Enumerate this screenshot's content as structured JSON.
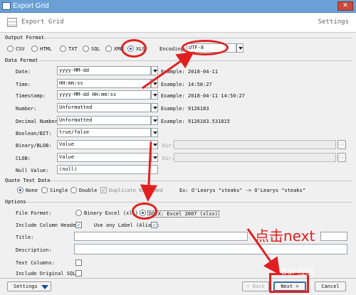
{
  "window": {
    "title": "Export Grid",
    "close_glyph": "✕"
  },
  "header": {
    "title": "Export Grid",
    "settings_label": "Settings"
  },
  "output_format": {
    "section_label": "Output Format",
    "options": [
      "CSV",
      "HTML",
      "TXT",
      "SQL",
      "XML",
      "XLS"
    ],
    "selected": "XLS",
    "encoding_label": "Encoding:",
    "encoding_value": "UTF-8"
  },
  "data_format": {
    "section_label": "Data Format",
    "rows": [
      {
        "label": "Date:",
        "value": "yyyy-MM-dd",
        "example": "Example: 2018-04-11"
      },
      {
        "label": "Time:",
        "value": "HH:mm:ss",
        "example": "Example: 14:50:27"
      },
      {
        "label": "Timestamp:",
        "value": "yyyy-MM-dd HH:mm:ss",
        "example": "Example: 2018-04-11 14:50:27"
      },
      {
        "label": "Number:",
        "value": "Unformatted",
        "example": "Example: 9126183"
      },
      {
        "label": "Decimal Number:",
        "value": "Unformatted",
        "example": "Example: 9126183.531815"
      },
      {
        "label": "Boolean/BIT:",
        "value": "true/false",
        "example": ""
      },
      {
        "label": "Binary/BLOB:",
        "value": "Value",
        "example": ""
      },
      {
        "label": "CLOB:",
        "value": "Value",
        "example": ""
      },
      {
        "label": "Null Value:",
        "value": "(null)",
        "example": ""
      }
    ],
    "dir_label": "Dir:",
    "browse_label": "..."
  },
  "quote_text": {
    "section_label": "Quote Text Data",
    "options": [
      "None",
      "Single",
      "Double"
    ],
    "selected": "None",
    "dup_embedded_label": "Duplicate Embedded",
    "example": "Ex: O'Learys \"steaks\" -> O'Learys \"steaks\""
  },
  "options": {
    "section_label": "Options",
    "file_format_label": "File Format:",
    "file_formats": [
      "Binary Excel (xls)",
      "DOCX: Excel 2007 (xlsx)"
    ],
    "file_format_selected": 1,
    "include_column_header_label": "Include Column Header:",
    "use_any_label_label": "Use any Label (Alias):",
    "title_label": "Title:",
    "description_label": "Description:",
    "text_columns_label": "Text Columns:",
    "include_original_sql_label": "Include Original SQL:"
  },
  "footer": {
    "settings_label": "Settings",
    "back_label": "< Back",
    "next_label": "Next >",
    "cancel_label": "Cancel"
  },
  "annotation": {
    "text": "点击next",
    "color": "#e02020"
  },
  "watermark": "Bai 经验"
}
